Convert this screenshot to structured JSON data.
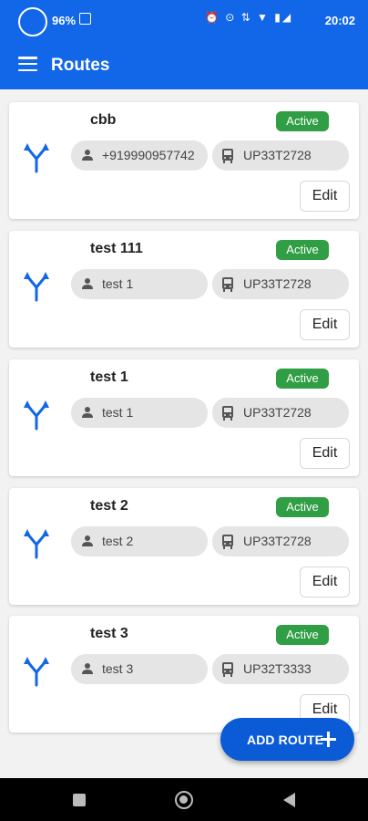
{
  "status_bar": {
    "battery_percent": "96%",
    "icons": "⏰ ⊙ ⇅ ▼ ▮◢",
    "time": "20:02"
  },
  "app_bar": {
    "title": "Routes",
    "menu_icon": "menu-icon"
  },
  "routes": [
    {
      "name": "cbb",
      "status": "Active",
      "contact": "+919990957742",
      "vehicle": "UP33T2728",
      "edit_label": "Edit"
    },
    {
      "name": "test 111",
      "status": "Active",
      "contact": "test 1",
      "vehicle": "UP33T2728",
      "edit_label": "Edit"
    },
    {
      "name": "test 1",
      "status": "Active",
      "contact": "test 1",
      "vehicle": "UP33T2728",
      "edit_label": "Edit"
    },
    {
      "name": "test 2",
      "status": "Active",
      "contact": "test 2",
      "vehicle": "UP33T2728",
      "edit_label": "Edit"
    },
    {
      "name": "test 3",
      "status": "Active",
      "contact": "test 3",
      "vehicle": "UP32T3333",
      "edit_label": "Edit"
    }
  ],
  "fab": {
    "label": "ADD ROUTE",
    "icon": "plus-icon"
  },
  "colors": {
    "primary": "#1167e8",
    "fab": "#0b5bd6",
    "status_active": "#2f9e44",
    "chip_bg": "#e5e5e5"
  }
}
